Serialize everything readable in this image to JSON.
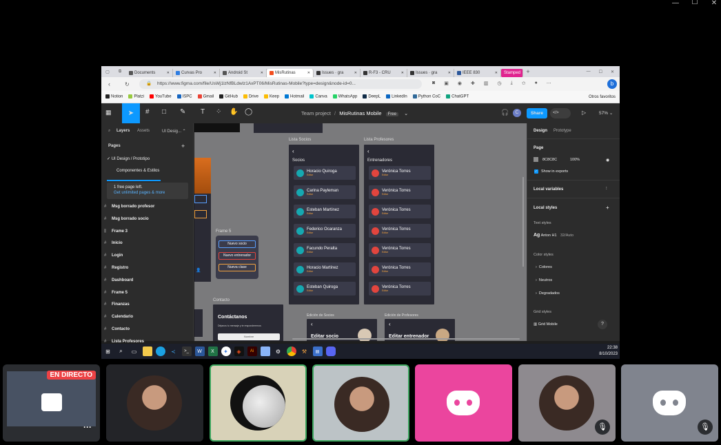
{
  "window_controls": {
    "minimize": "—",
    "maximize": "☐",
    "close": "✕"
  },
  "browser": {
    "tabs": [
      {
        "label": "Documents",
        "color": "#555"
      },
      {
        "label": "Curvas Pro",
        "color": "#2e7de1"
      },
      {
        "label": "Android St",
        "color": "#555"
      },
      {
        "label": "MisRutinas",
        "color": "#f24e1e",
        "active": true
      },
      {
        "label": "Issues · gra",
        "color": "#333"
      },
      {
        "label": "R-F3 - CRU",
        "color": "#333"
      },
      {
        "label": "Issues · gra",
        "color": "#333"
      },
      {
        "label": "IEEE 830",
        "color": "#2b579a"
      },
      {
        "label": "Stamped",
        "color": "#e0248f"
      }
    ],
    "url": "https://www.figma.com/file/UsWj1lzNfBLdwlz1AxPT06/MisRutinas-Mobile?type=design&node-id=0...",
    "bookmarks": [
      {
        "label": "Notion",
        "color": "#222"
      },
      {
        "label": "Platzi",
        "color": "#98ca3f"
      },
      {
        "label": "YouTube",
        "color": "#ff0000"
      },
      {
        "label": "ISPC",
        "color": "#1565c0"
      },
      {
        "label": "Gmail",
        "color": "#ea4335"
      },
      {
        "label": "GitHub",
        "color": "#222"
      },
      {
        "label": "Drive",
        "color": "#fbbc04"
      },
      {
        "label": "Keep",
        "color": "#fbbc04"
      },
      {
        "label": "Hotmail",
        "color": "#0078d4"
      },
      {
        "label": "Canva",
        "color": "#00c4cc"
      },
      {
        "label": "WhatsApp",
        "color": "#25d366"
      },
      {
        "label": "DeepL",
        "color": "#0f2b46"
      },
      {
        "label": "LinkedIn",
        "color": "#0a66c2"
      },
      {
        "label": "Python CoC",
        "color": "#306998"
      },
      {
        "label": "ChatGPT",
        "color": "#10a37f"
      }
    ],
    "other_favorites": "Otros favoritos"
  },
  "figma": {
    "breadcrumb_team": "Team project",
    "separator": "/",
    "file_name": "MisRutinas Mobile",
    "plan_badge": "Free",
    "share_label": "Share",
    "zoom": "57%",
    "avatar_letter": "C",
    "left_tabs": {
      "layers": "Layers",
      "assets": "Assets",
      "page_dropdown": "UI Desig..."
    },
    "pages_title": "Pages",
    "pages": [
      "UI Design / Prototipo",
      "Componentes & Estilos"
    ],
    "upsell": {
      "line1": "1 free page left.",
      "line2": "Get unlimited pages & more"
    },
    "layers": [
      "Msg borrado profesor",
      "Msg borrado socio",
      "Frame 3",
      "Inicio",
      "Login",
      "Registro",
      "Dashboard",
      "Frame 5",
      "Finanzas",
      "Calendario",
      "Contacto",
      "Lista Profesores"
    ],
    "right_tabs": {
      "design": "Design",
      "prototype": "Prototype"
    },
    "right": {
      "page_title": "Page",
      "page_color": "8C8C8C",
      "page_opacity": "100%",
      "show_exports": "Show in exports",
      "local_variables": "Local variables",
      "local_styles": "Local styles",
      "text_styles": "Text styles",
      "text_style_item": "Anton H1",
      "text_style_meta": "32/Auto",
      "color_styles": "Color styles",
      "color_items": [
        "Colores",
        "Neutros",
        "Degradados"
      ],
      "grid_styles": "Grid styles",
      "grid_item": "Grid Mobile",
      "help": "?"
    },
    "canvas": {
      "lista_socios": {
        "label": "Lista Socios",
        "header": "Socios",
        "members": [
          "Horacio Quiroga",
          "Carina Payleman",
          "Esteban Martínez",
          "Federico Ocaranza",
          "Facundo Peralta",
          "Horacio Martínez",
          "Esteban Quiroga"
        ],
        "tag": "Editar",
        "icon_color": "#16a8b0"
      },
      "lista_profesores": {
        "label": "Lista Profesores",
        "header": "Entrenadores",
        "members": [
          "Verónica Torres",
          "Verónica Torres",
          "Verónica Torres",
          "Verónica Torres",
          "Verónica Torres",
          "Verónica Torres",
          "Verónica Torres"
        ],
        "tag": "Editar",
        "icon_color": "#e2453e"
      },
      "frame5": {
        "label": "Frame 5",
        "buttons": [
          "Nuevo socio",
          "Nuevo entrenador",
          "Nueva clase"
        ]
      },
      "contacto": {
        "label": "Contacto",
        "title": "Contáctanos",
        "subtitle": "Déjanos tu mensaje y te responderemos",
        "field": "Nombre"
      },
      "edicion_socio": {
        "label": "Edición de Socios",
        "title": "Editar socio"
      },
      "edicion_prof": {
        "label": "Edición de Profesores",
        "title": "Editar entrenador"
      }
    }
  },
  "taskbar": {
    "time": "22:38",
    "date": "8/10/2023"
  },
  "call": {
    "live_badge": "EN DIRECTO",
    "more": "···",
    "tiles": [
      {
        "kind": "screen",
        "bg": "#2b2d31"
      },
      {
        "kind": "avatar",
        "bg": "#232428"
      },
      {
        "kind": "moon",
        "bg": "#d8d2b8",
        "speaking": true
      },
      {
        "kind": "avatar",
        "bg": "#bcc3c6",
        "speaking": true
      },
      {
        "kind": "discord",
        "bg": "#eb459e"
      },
      {
        "kind": "avatar",
        "bg": "#8e8a8f",
        "muted": true
      },
      {
        "kind": "discord",
        "bg": "#80848e",
        "muted": true
      }
    ]
  }
}
